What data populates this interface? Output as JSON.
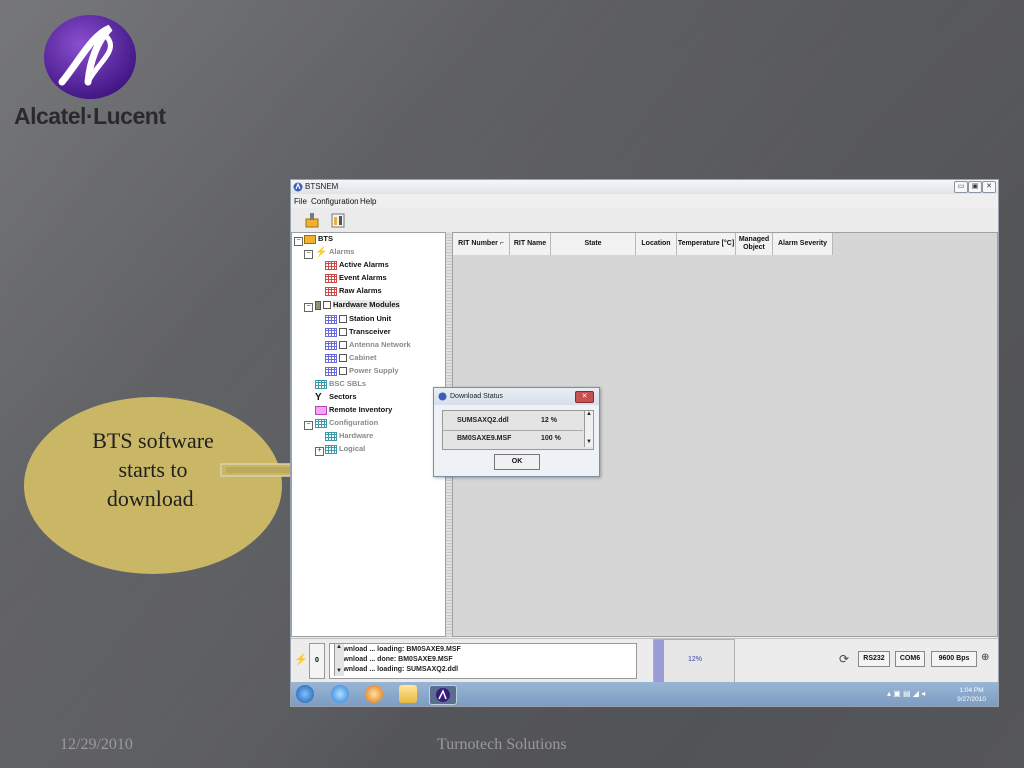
{
  "slide": {
    "logo_text": "Alcatel·Lucent",
    "callout_line1": "BTS software",
    "callout_line2": "starts to",
    "callout_line3": "download",
    "callout_period": ".",
    "footer_date": "12/29/2010",
    "footer_company": "Turnotech Solutions"
  },
  "window": {
    "title": "BTSNEM",
    "menu": [
      "File",
      "Configuration",
      "Help"
    ]
  },
  "tree": {
    "items": [
      {
        "label": "BTS",
        "grey": false
      },
      {
        "label": "Alarms",
        "grey": true
      },
      {
        "label": "Active Alarms",
        "grey": false
      },
      {
        "label": "Event Alarms",
        "grey": false
      },
      {
        "label": "Raw Alarms",
        "grey": false
      },
      {
        "label": "Hardware Modules",
        "grey": false
      },
      {
        "label": "Station Unit",
        "grey": false
      },
      {
        "label": "Transceiver",
        "grey": false
      },
      {
        "label": "Antenna Network",
        "grey": true
      },
      {
        "label": "Cabinet",
        "grey": true
      },
      {
        "label": "Power Supply",
        "grey": true
      },
      {
        "label": "BSC SBLs",
        "grey": true
      },
      {
        "label": "Sectors",
        "grey": false
      },
      {
        "label": "Remote Inventory",
        "grey": false
      },
      {
        "label": "Configuration",
        "grey": true
      },
      {
        "label": "Hardware",
        "grey": true
      },
      {
        "label": "Logical",
        "grey": true
      }
    ]
  },
  "table": {
    "columns": [
      {
        "label": "RIT Number",
        "sort": "⌐"
      },
      {
        "label": "RIT Name"
      },
      {
        "label": "State"
      },
      {
        "label": "Location"
      },
      {
        "label": "Temperature [°C]"
      },
      {
        "label": "Managed Object"
      },
      {
        "label": "Alarm Severity"
      }
    ]
  },
  "status": {
    "alarm_count": "0",
    "log": [
      "Download ... loading: BM0SAXE9.MSF",
      "Download ... done: BM0SAXE9.MSF",
      "Download ... loading: SUMSAXQ2.ddl"
    ],
    "progress_text": "12%",
    "progress_value": 0.12,
    "port": "RS232",
    "com": "COM6",
    "baud": "9600 Bps"
  },
  "taskbar": {
    "time": "1:04 PM",
    "date": "9/27/2010"
  },
  "dialog": {
    "title": "Download Status",
    "rows": [
      {
        "file": "SUMSAXQ2.ddl",
        "percent": "12 %"
      },
      {
        "file": "BM0SAXE9.MSF",
        "percent": "100 %"
      }
    ],
    "ok_label": "OK"
  },
  "colors": {
    "callout": "#c9b766",
    "arrow": "#c9b766",
    "progress": "#9b9bd8"
  }
}
